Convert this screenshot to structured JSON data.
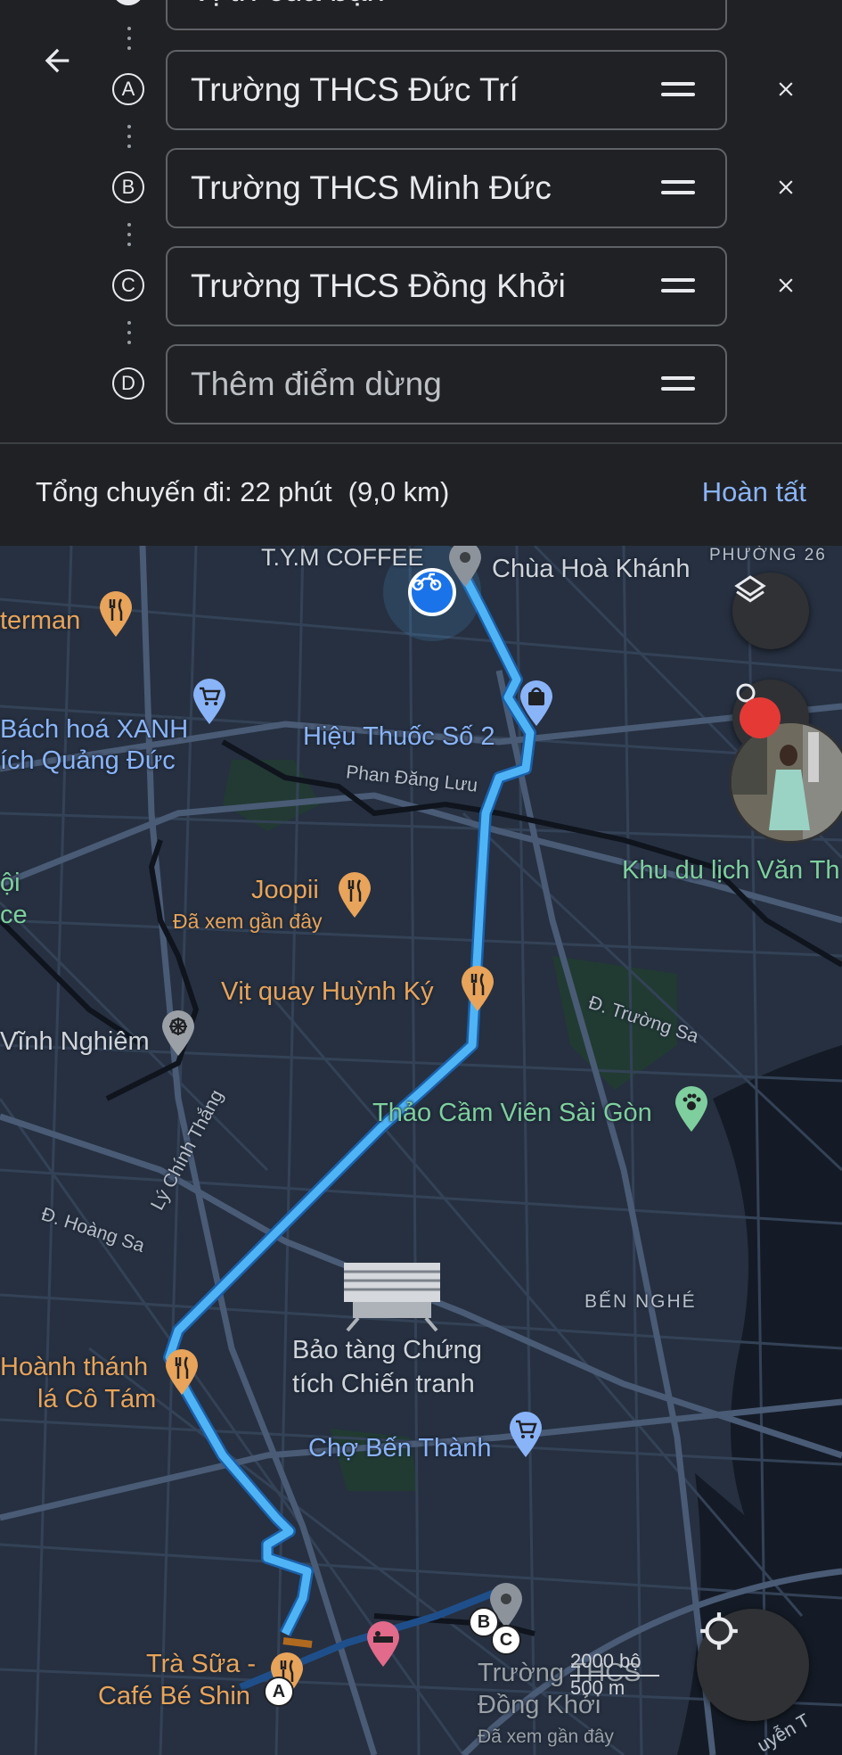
{
  "header": {
    "origin_text": "Vị trí của bạn",
    "stops": [
      {
        "letter": "A",
        "name": "Trường THCS Đức Trí",
        "removable": true
      },
      {
        "letter": "B",
        "name": "Trường THCS Minh Đức",
        "removable": true
      },
      {
        "letter": "C",
        "name": "Trường THCS Đồng Khởi",
        "removable": true
      }
    ],
    "add_stop": {
      "letter": "D",
      "placeholder": "Thêm điểm dừng"
    },
    "summary_label": "Tổng chuyến đi: 22 phút",
    "summary_distance": "(9,0 km)",
    "done_label": "Hoàn tất"
  },
  "map": {
    "labels": {
      "tym_coffee": "T.Y.M COFFEE",
      "chua_hoa_khanh": "Chùa Hoà Khánh",
      "phuong_26": "PHƯỜNG 26",
      "waterman": "terman",
      "bach_hoa_xanh": "Bách hoá XANH",
      "quang_duc": "ích Quảng Đức",
      "hieu_thuoc": "Hiệu Thuốc Số 2",
      "phan_dang_luu": "Phan Đăng Lưu",
      "khu_du_lich": "Khu du lịch Văn Th",
      "hoi": "ội",
      "ce": "ce",
      "joopii": "Joopii",
      "joopii_sub": "Đã xem gần đây",
      "vit_quay": "Vịt quay Huỳnh Ký",
      "truong_sa": "Đ. Trường Sa",
      "vinh_nghiem": "Vĩnh Nghiêm",
      "thao_cam_vien": "Thảo Cầm Viên Sài Gòn",
      "hoang_sa": "Đ. Hoàng Sa",
      "ly_chinh_thang": "Lý Chính Thắng",
      "ben_nghe": "BẾN NGHÉ",
      "bao_tang_1": "Bảo tàng Chứng",
      "bao_tang_2": "tích Chiến tranh",
      "hoanh_thanh_1": "Hoành thánh",
      "hoanh_thanh_2": "lá Cô Tám",
      "cho_ben_thanh": "Chợ Bến Thành",
      "tra_sua_1": "Trà Sữa -",
      "tra_sua_2": "Café Bé Shin",
      "dong_khoi_1": "Trường THCS",
      "dong_khoi_2": "Đồng Khởi",
      "dong_khoi_sub": "Đã xem gần đây",
      "nguyen": "uyễn T"
    },
    "scale": {
      "top": "2000 bộ",
      "bottom": "500 m"
    },
    "waypoints": [
      "A",
      "B",
      "C"
    ],
    "route_color": "#4fb4f5",
    "icons": [
      "layers-icon",
      "my-location-icon",
      "motorbike-icon"
    ]
  }
}
